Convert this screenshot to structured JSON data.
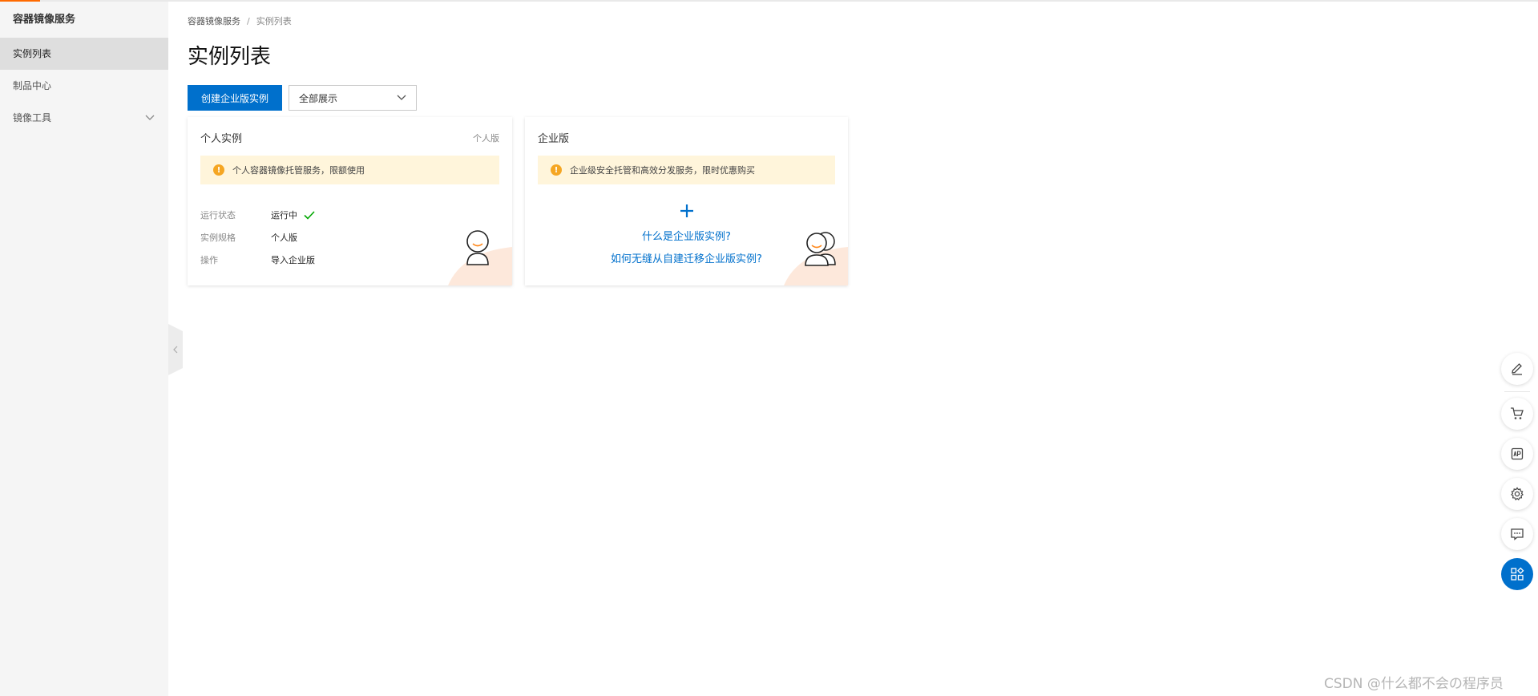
{
  "sidebar": {
    "title": "容器镜像服务",
    "items": [
      {
        "label": "实例列表"
      },
      {
        "label": "制品中心"
      },
      {
        "label": "镜像工具"
      }
    ]
  },
  "breadcrumb": {
    "root": "容器镜像服务",
    "separator": "/",
    "current": "实例列表"
  },
  "page": {
    "title": "实例列表"
  },
  "toolbar": {
    "create_label": "创建企业版实例",
    "filter_value": "全部展示"
  },
  "cards": {
    "personal": {
      "title": "个人实例",
      "tag": "个人版",
      "notice": "个人容器镜像托管服务，限额使用",
      "rows": [
        {
          "label": "运行状态",
          "value": "运行中"
        },
        {
          "label": "实例规格",
          "value": "个人版"
        },
        {
          "label": "操作",
          "value": "导入企业版"
        }
      ]
    },
    "enterprise": {
      "title": "企业版",
      "notice": "企业级安全托管和高效分发服务，限时优惠购买",
      "link_what": "什么是企业版实例?",
      "link_migrate": "如何无缝从自建迁移企业版实例?"
    }
  },
  "watermark": "CSDN @什么都不会の程序员",
  "colors": {
    "primary": "#0070cc",
    "accent": "#ff6a00",
    "notice_bg": "#fff5db",
    "warning": "#f5a623",
    "success": "#00a700",
    "corner_decor": "#fde8db"
  }
}
